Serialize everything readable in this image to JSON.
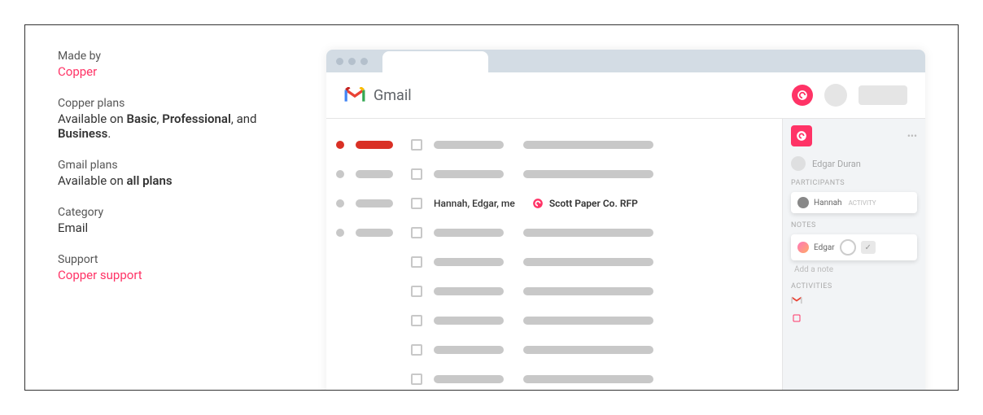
{
  "meta": {
    "made_by_label": "Made by",
    "made_by_value": "Copper",
    "plans_label": "Copper plans",
    "plans_prefix": "Available on ",
    "plans_b1": "Basic",
    "plans_mid1": ", ",
    "plans_b2": "Professional",
    "plans_mid2": ", and ",
    "plans_b3": "Business",
    "plans_suffix": ".",
    "gmail_plans_label": "Gmail plans",
    "gmail_plans_prefix": "Available on ",
    "gmail_plans_bold": "all plans",
    "category_label": "Category",
    "category_value": "Email",
    "support_label": "Support",
    "support_value": "Copper support"
  },
  "gmail": {
    "title": "Gmail",
    "row_sender": "Hannah, Edgar, me",
    "row_subject": "Scott Paper Co. RFP"
  },
  "sidebar": {
    "contact_name": "Edgar Duran",
    "participants_label": "Participants",
    "participant_name": "Hannah",
    "participant_sub": "ACTIVITY",
    "notes_label": "Notes",
    "note_name": "Edgar",
    "add_note": "Add a note",
    "activities_label": "Activities"
  }
}
